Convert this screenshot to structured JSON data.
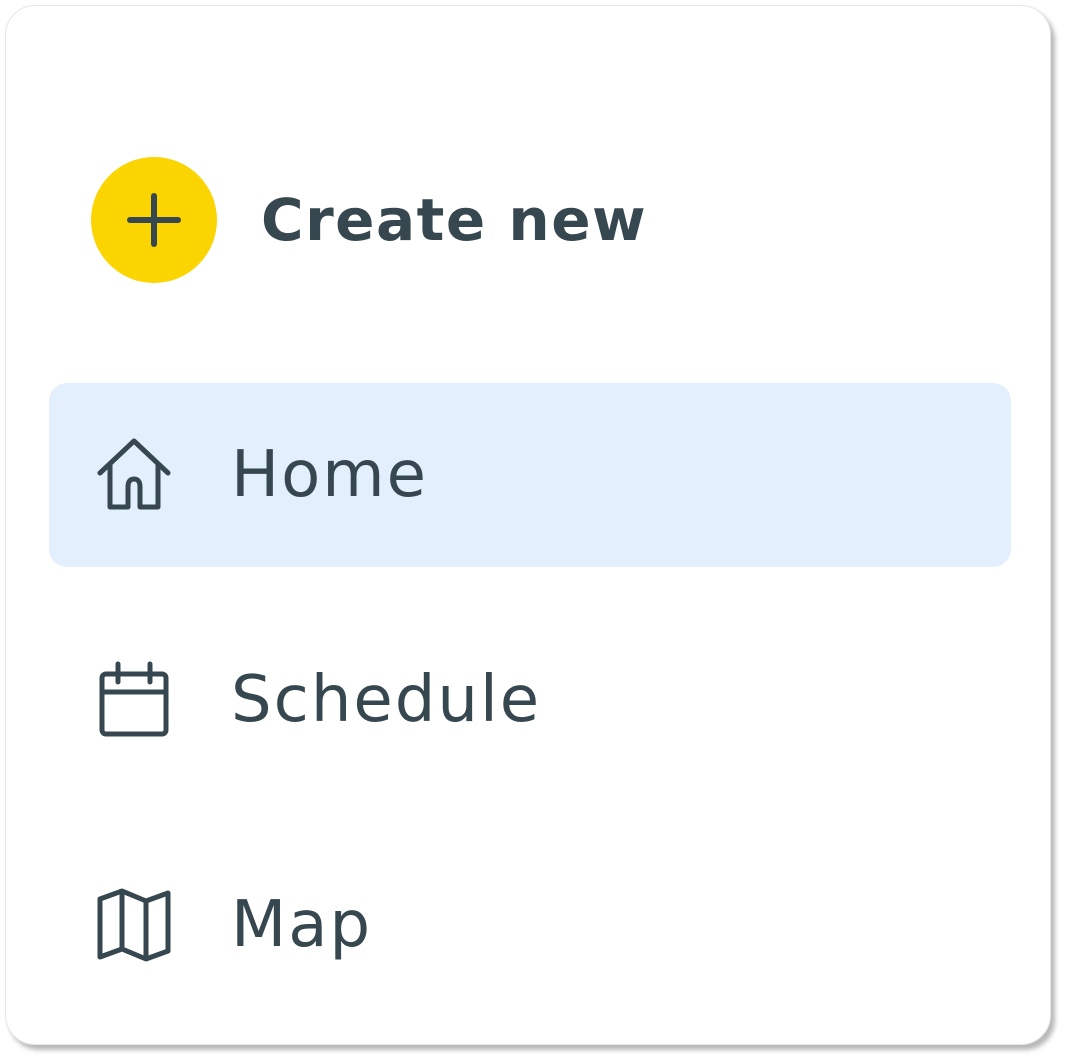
{
  "create": {
    "label": "Create new",
    "icon": "plus-icon",
    "accent_color": "#fad501"
  },
  "nav": {
    "items": [
      {
        "label": "Home",
        "icon": "home-icon",
        "active": true
      },
      {
        "label": "Schedule",
        "icon": "calendar-icon",
        "active": false
      },
      {
        "label": "Map",
        "icon": "map-icon",
        "active": false
      }
    ],
    "active_background": "#e3effd"
  },
  "colors": {
    "text": "#37474f",
    "card_background": "#ffffff"
  }
}
